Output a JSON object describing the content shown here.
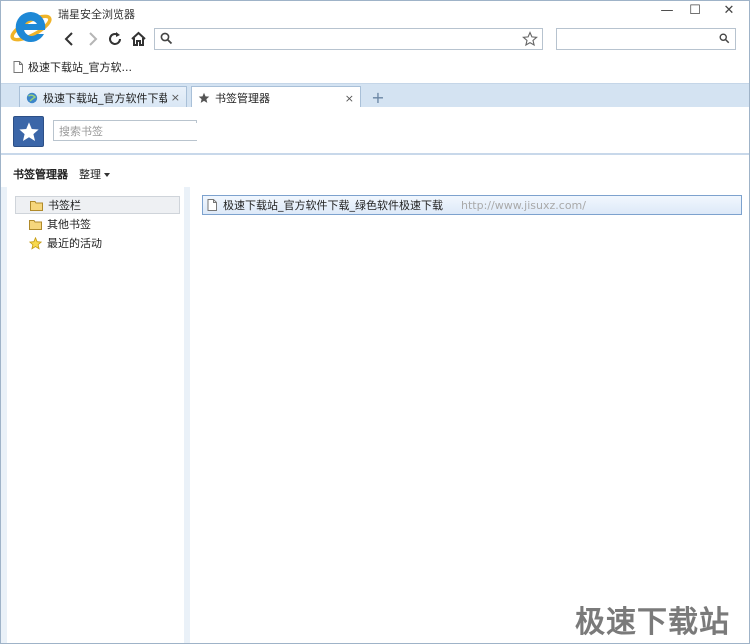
{
  "app": {
    "title": "瑞星安全浏览器"
  },
  "window_controls": {
    "minimize": "—",
    "maximize": "☐",
    "close": "✕"
  },
  "address_bar": {
    "value": "",
    "placeholder": ""
  },
  "search_bar": {
    "value": "",
    "placeholder": ""
  },
  "bookmarks_bar": {
    "items": [
      {
        "label": "极速下载站_官方软..."
      }
    ]
  },
  "tabs": [
    {
      "label": "极速下载站_官方软件下载",
      "close": "×",
      "active": false
    },
    {
      "label": "书签管理器",
      "close": "×",
      "active": true
    }
  ],
  "new_tab_label": "+",
  "bookmark_manager": {
    "search_placeholder": "搜索书签",
    "toolbar_title": "书签管理器",
    "organize_menu": "整理",
    "tree": [
      {
        "label": "书签栏",
        "icon": "folder-icon",
        "selected": true
      },
      {
        "label": "其他书签",
        "icon": "folder-icon",
        "selected": false
      },
      {
        "label": "最近的活动",
        "icon": "star-icon",
        "selected": false
      }
    ],
    "entries": [
      {
        "title": "极速下载站_官方软件下载_绿色软件极速下载",
        "url": "http://www.jisuxz.com/"
      }
    ]
  },
  "watermark": "极速下载站",
  "colors": {
    "accent": "#3b66a8",
    "tabstrip": "#d4e3f2",
    "selection_border": "#7da2ce"
  }
}
